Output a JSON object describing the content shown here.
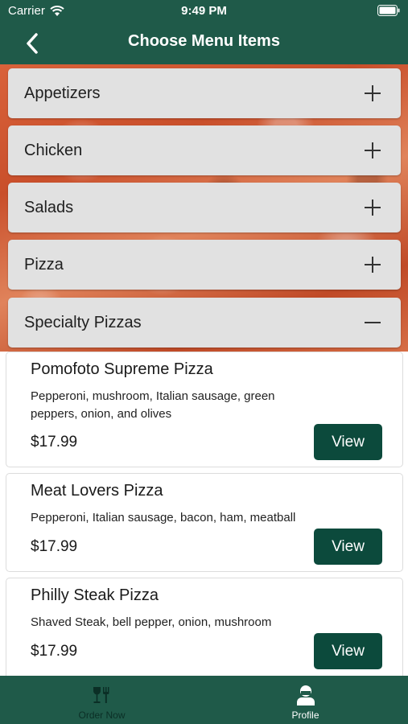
{
  "status_bar": {
    "carrier": "Carrier",
    "time": "9:49 PM"
  },
  "nav": {
    "title": "Choose Menu Items"
  },
  "categories": [
    {
      "label": "Appetizers",
      "state": "collapsed",
      "icon": "plus-icon"
    },
    {
      "label": "Chicken",
      "state": "collapsed",
      "icon": "plus-icon"
    },
    {
      "label": "Salads",
      "state": "collapsed",
      "icon": "plus-icon"
    },
    {
      "label": "Pizza",
      "state": "collapsed",
      "icon": "plus-icon"
    },
    {
      "label": "Specialty Pizzas",
      "state": "expanded",
      "icon": "minus-icon"
    }
  ],
  "items": [
    {
      "name": "Pomofoto Supreme Pizza",
      "description": "Pepperoni, mushroom, Italian sausage, green peppers, onion, and olives",
      "price": "$17.99",
      "button": "View"
    },
    {
      "name": "Meat Lovers Pizza",
      "description": "Pepperoni, Italian sausage, bacon, ham, meatball",
      "price": "$17.99",
      "button": "View"
    },
    {
      "name": "Philly Steak Pizza",
      "description": "Shaved Steak, bell pepper, onion, mushroom",
      "price": "$17.99",
      "button": "View"
    }
  ],
  "tabbar": {
    "tabs": [
      {
        "label": "Order Now",
        "icon": "wine-fork-icon",
        "active": false
      },
      {
        "label": "Profile",
        "icon": "person-icon",
        "active": true
      }
    ]
  },
  "colors": {
    "header": "#1f5a49",
    "button": "#0c4a3c",
    "category_bg": "#e1e1e1"
  }
}
